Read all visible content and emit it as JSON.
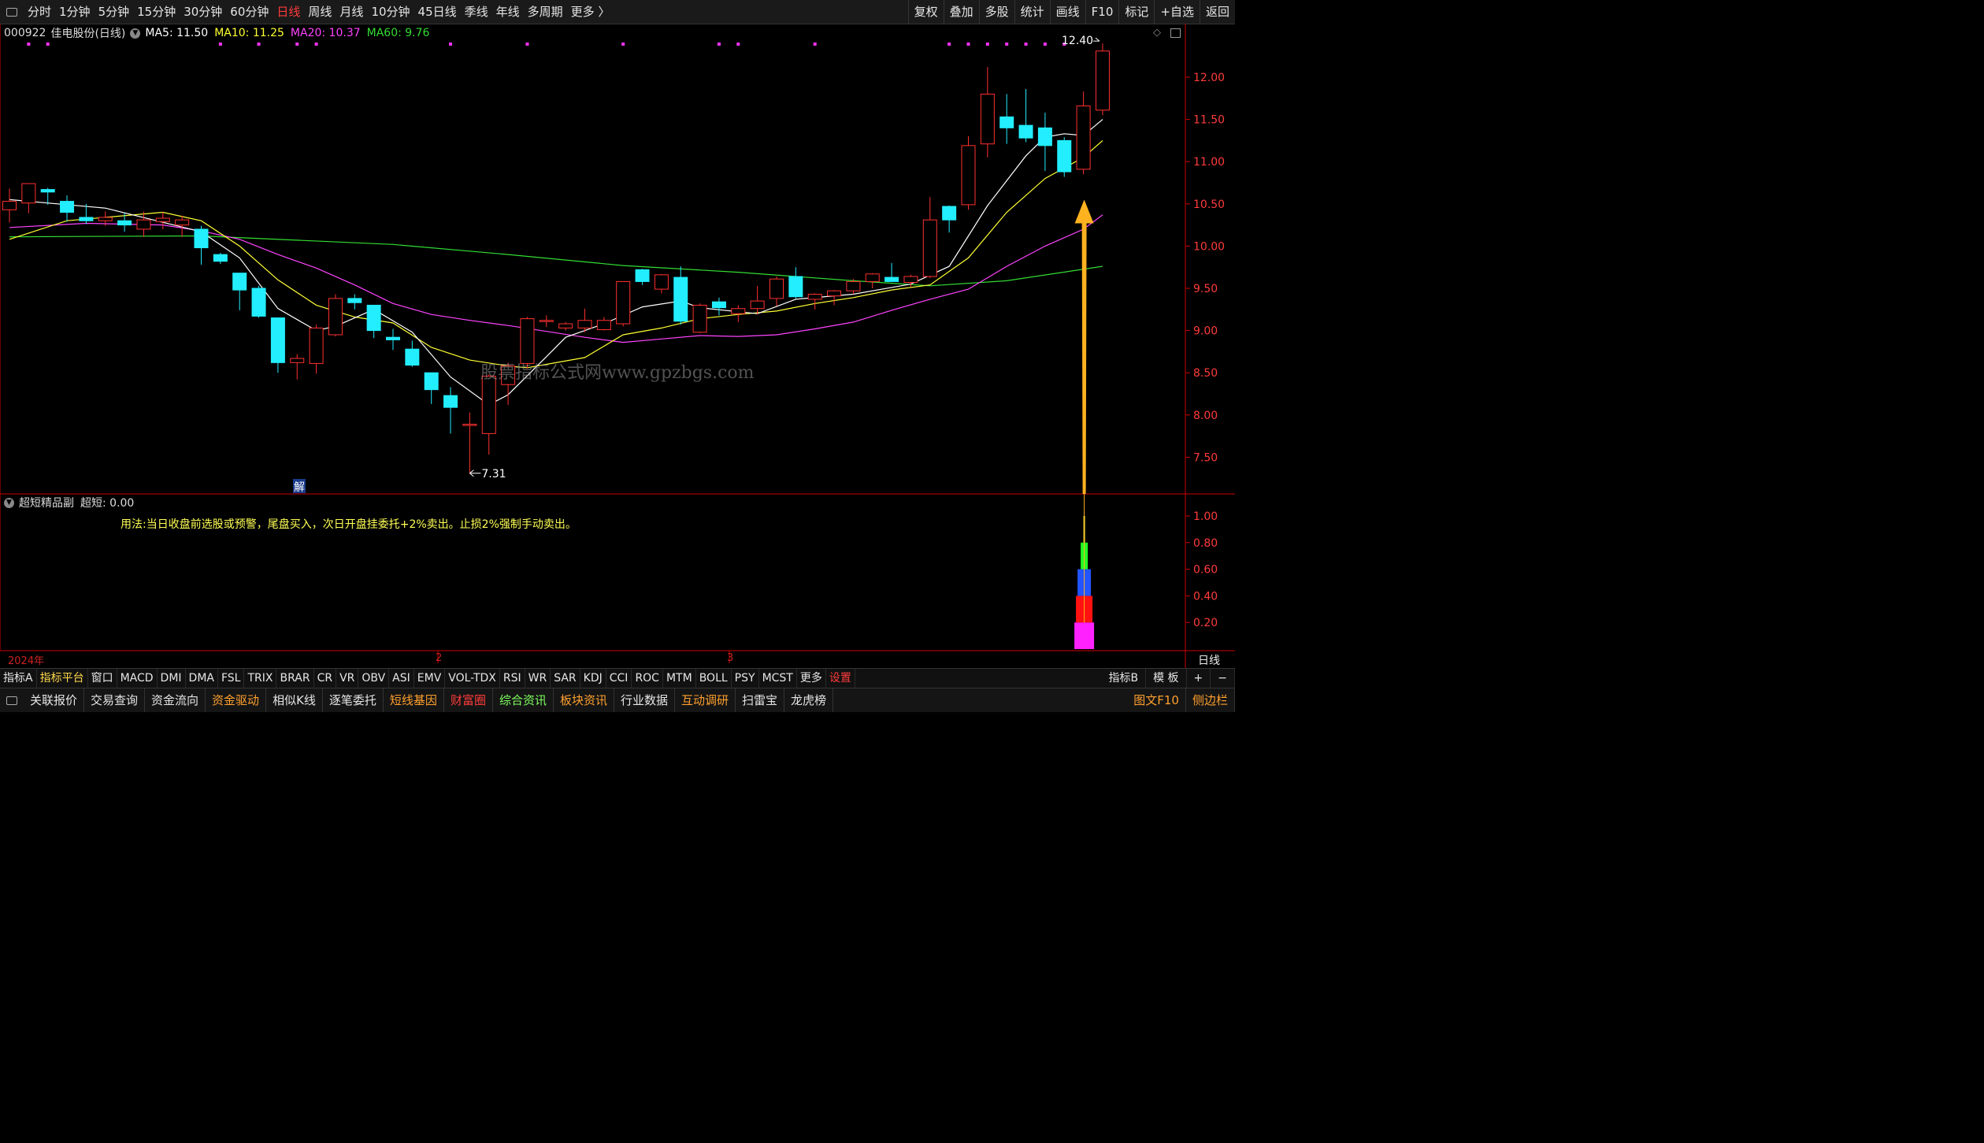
{
  "periods": [
    "分时",
    "1分钟",
    "5分钟",
    "15分钟",
    "30分钟",
    "60分钟",
    "日线",
    "周线",
    "月线",
    "10分钟",
    "45日线",
    "季线",
    "年线",
    "多周期",
    "更多 〉"
  ],
  "active_period": "日线",
  "top_right": [
    "复权",
    "叠加",
    "多股",
    "统计",
    "画线",
    "F10",
    "标记",
    "+自选",
    "返回"
  ],
  "stock": {
    "code": "000922",
    "name": "佳电股份",
    "period": "(日线)"
  },
  "ma_legend": [
    {
      "label": "MA5: 11.50",
      "color": "#ffffff"
    },
    {
      "label": "MA10: 11.25",
      "color": "#ffff33"
    },
    {
      "label": "MA20: 10.37",
      "color": "#ff44ff"
    },
    {
      "label": "MA60: 9.76",
      "color": "#33dd33"
    }
  ],
  "price_axis": [
    "12.00",
    "11.50",
    "11.00",
    "10.50",
    "10.00",
    "9.50",
    "9.00",
    "8.50",
    "8.00",
    "7.50"
  ],
  "annotations": {
    "high_label": "12.40",
    "low_label": "7.31",
    "jie": "解",
    "watermark": "股票指标公式网www.gpzbgs.com"
  },
  "sub_panel": {
    "title": "超短精品副",
    "value_label": "超短: 0.00",
    "note": "用法:当日收盘前选股或预警，尾盘买入，次日开盘挂委托+2%卖出。止损2%强制手动卖出。",
    "axis": [
      "1.00",
      "0.80",
      "0.60",
      "0.40",
      "0.20"
    ]
  },
  "time_axis": {
    "year": "2024年",
    "m2": "2",
    "m3": "3",
    "period_label": "日线"
  },
  "indicator_tabs": [
    "指标A",
    "指标平台",
    "窗口",
    "MACD",
    "DMI",
    "DMA",
    "FSL",
    "TRIX",
    "BRAR",
    "CR",
    "VR",
    "OBV",
    "ASI",
    "EMV",
    "VOL-TDX",
    "RSI",
    "WR",
    "SAR",
    "KDJ",
    "CCI",
    "ROC",
    "MTM",
    "BOLL",
    "PSY",
    "MCST",
    "更多",
    "设置"
  ],
  "indicator_right": [
    "指标B",
    "模 板",
    "+",
    "−"
  ],
  "func_buttons": [
    {
      "label": "关联报价",
      "c": ""
    },
    {
      "label": "交易查询",
      "c": ""
    },
    {
      "label": "资金流向",
      "c": ""
    },
    {
      "label": "资金驱动",
      "c": "o"
    },
    {
      "label": "相似K线",
      "c": ""
    },
    {
      "label": "逐笔委托",
      "c": ""
    },
    {
      "label": "短线基因",
      "c": "o"
    },
    {
      "label": "财富圈",
      "c": "r"
    },
    {
      "label": "综合资讯",
      "c": "g"
    },
    {
      "label": "板块资讯",
      "c": "o"
    },
    {
      "label": "行业数据",
      "c": ""
    },
    {
      "label": "互动调研",
      "c": "o"
    },
    {
      "label": "扫雷宝",
      "c": ""
    },
    {
      "label": "龙虎榜",
      "c": ""
    }
  ],
  "func_right": [
    "图文F10",
    "侧边栏"
  ],
  "chart_data": {
    "type": "candlestick",
    "candles": [
      {
        "o": 10.43,
        "h": 10.68,
        "l": 10.28,
        "c": 10.53
      },
      {
        "o": 10.51,
        "h": 10.74,
        "l": 10.39,
        "c": 10.74
      },
      {
        "o": 10.67,
        "h": 10.69,
        "l": 10.49,
        "c": 10.64
      },
      {
        "o": 10.53,
        "h": 10.6,
        "l": 10.29,
        "c": 10.4
      },
      {
        "o": 10.34,
        "h": 10.5,
        "l": 10.26,
        "c": 10.3
      },
      {
        "o": 10.3,
        "h": 10.41,
        "l": 10.24,
        "c": 10.34
      },
      {
        "o": 10.3,
        "h": 10.39,
        "l": 10.17,
        "c": 10.25
      },
      {
        "o": 10.2,
        "h": 10.41,
        "l": 10.11,
        "c": 10.31
      },
      {
        "o": 10.29,
        "h": 10.4,
        "l": 10.2,
        "c": 10.33
      },
      {
        "o": 10.25,
        "h": 10.36,
        "l": 10.11,
        "c": 10.31
      },
      {
        "o": 10.2,
        "h": 10.24,
        "l": 9.78,
        "c": 9.98
      },
      {
        "o": 9.9,
        "h": 9.92,
        "l": 9.79,
        "c": 9.82
      },
      {
        "o": 9.68,
        "h": 9.68,
        "l": 9.24,
        "c": 9.48
      },
      {
        "o": 9.5,
        "h": 9.53,
        "l": 9.15,
        "c": 9.17
      },
      {
        "o": 9.15,
        "h": 9.15,
        "l": 8.5,
        "c": 8.62
      },
      {
        "o": 8.62,
        "h": 8.72,
        "l": 8.42,
        "c": 8.67
      },
      {
        "o": 8.61,
        "h": 9.07,
        "l": 8.49,
        "c": 9.03
      },
      {
        "o": 8.95,
        "h": 9.43,
        "l": 8.93,
        "c": 9.38
      },
      {
        "o": 9.38,
        "h": 9.43,
        "l": 9.25,
        "c": 9.33
      },
      {
        "o": 9.3,
        "h": 9.3,
        "l": 8.91,
        "c": 9.0
      },
      {
        "o": 8.92,
        "h": 9.02,
        "l": 8.77,
        "c": 8.89
      },
      {
        "o": 8.78,
        "h": 8.88,
        "l": 8.57,
        "c": 8.59
      },
      {
        "o": 8.5,
        "h": 8.5,
        "l": 8.13,
        "c": 8.3
      },
      {
        "o": 8.23,
        "h": 8.33,
        "l": 7.78,
        "c": 8.09
      },
      {
        "o": 7.89,
        "h": 8.03,
        "l": 7.31,
        "c": 7.89
      },
      {
        "o": 7.78,
        "h": 8.48,
        "l": 7.53,
        "c": 8.46
      },
      {
        "o": 8.36,
        "h": 8.62,
        "l": 8.12,
        "c": 8.58
      },
      {
        "o": 8.61,
        "h": 9.16,
        "l": 8.55,
        "c": 9.14
      },
      {
        "o": 9.12,
        "h": 9.18,
        "l": 9.04,
        "c": 9.12
      },
      {
        "o": 9.03,
        "h": 9.1,
        "l": 9.0,
        "c": 9.08
      },
      {
        "o": 9.03,
        "h": 9.26,
        "l": 8.98,
        "c": 9.12
      },
      {
        "o": 9.01,
        "h": 9.16,
        "l": 9.0,
        "c": 9.12
      },
      {
        "o": 9.08,
        "h": 9.58,
        "l": 9.05,
        "c": 9.58
      },
      {
        "o": 9.72,
        "h": 9.73,
        "l": 9.54,
        "c": 9.58
      },
      {
        "o": 9.49,
        "h": 9.67,
        "l": 9.44,
        "c": 9.66
      },
      {
        "o": 9.63,
        "h": 9.76,
        "l": 9.07,
        "c": 9.11
      },
      {
        "o": 8.98,
        "h": 9.32,
        "l": 8.97,
        "c": 9.3
      },
      {
        "o": 9.34,
        "h": 9.39,
        "l": 9.18,
        "c": 9.27
      },
      {
        "o": 9.2,
        "h": 9.3,
        "l": 9.1,
        "c": 9.26
      },
      {
        "o": 9.26,
        "h": 9.53,
        "l": 9.19,
        "c": 9.35
      },
      {
        "o": 9.38,
        "h": 9.64,
        "l": 9.29,
        "c": 9.61
      },
      {
        "o": 9.64,
        "h": 9.75,
        "l": 9.38,
        "c": 9.4
      },
      {
        "o": 9.37,
        "h": 9.44,
        "l": 9.25,
        "c": 9.43
      },
      {
        "o": 9.41,
        "h": 9.48,
        "l": 9.3,
        "c": 9.47
      },
      {
        "o": 9.47,
        "h": 9.61,
        "l": 9.43,
        "c": 9.58
      },
      {
        "o": 9.58,
        "h": 9.68,
        "l": 9.5,
        "c": 9.67
      },
      {
        "o": 9.63,
        "h": 9.8,
        "l": 9.58,
        "c": 9.58
      },
      {
        "o": 9.57,
        "h": 9.66,
        "l": 9.52,
        "c": 9.64
      },
      {
        "o": 9.64,
        "h": 10.58,
        "l": 9.62,
        "c": 10.31
      },
      {
        "o": 10.47,
        "h": 10.48,
        "l": 10.16,
        "c": 10.31
      },
      {
        "o": 10.49,
        "h": 11.3,
        "l": 10.43,
        "c": 11.19
      },
      {
        "o": 11.21,
        "h": 12.12,
        "l": 11.05,
        "c": 11.8
      },
      {
        "o": 11.53,
        "h": 11.8,
        "l": 11.21,
        "c": 11.4
      },
      {
        "o": 11.43,
        "h": 11.86,
        "l": 11.23,
        "c": 11.28
      },
      {
        "o": 11.4,
        "h": 11.58,
        "l": 10.89,
        "c": 11.19
      },
      {
        "o": 11.25,
        "h": 11.29,
        "l": 10.82,
        "c": 10.88
      },
      {
        "o": 10.91,
        "h": 11.83,
        "l": 10.85,
        "c": 11.66
      },
      {
        "o": 11.61,
        "h": 12.4,
        "l": 11.55,
        "c": 12.31
      }
    ],
    "ma5": [
      [
        0,
        10.55
      ],
      [
        5,
        10.45
      ],
      [
        10,
        10.17
      ],
      [
        12,
        9.86
      ],
      [
        14,
        9.26
      ],
      [
        16,
        9.0
      ],
      [
        17,
        9.05
      ],
      [
        19,
        9.25
      ],
      [
        21,
        8.98
      ],
      [
        23,
        8.45
      ],
      [
        25,
        8.12
      ],
      [
        26,
        8.24
      ],
      [
        28,
        8.69
      ],
      [
        29,
        8.92
      ],
      [
        31,
        9.08
      ],
      [
        33,
        9.28
      ],
      [
        35,
        9.35
      ],
      [
        36,
        9.27
      ],
      [
        39,
        9.2
      ],
      [
        41,
        9.37
      ],
      [
        44,
        9.43
      ],
      [
        47,
        9.55
      ],
      [
        49,
        9.76
      ],
      [
        51,
        10.48
      ],
      [
        53,
        11.07
      ],
      [
        54,
        11.29
      ],
      [
        55,
        11.33
      ],
      [
        56,
        11.31
      ],
      [
        57,
        11.5
      ]
    ],
    "ma10": [
      [
        0,
        10.08
      ],
      [
        3,
        10.3
      ],
      [
        8,
        10.4
      ],
      [
        10,
        10.3
      ],
      [
        12,
        10.0
      ],
      [
        14,
        9.6
      ],
      [
        16,
        9.3
      ],
      [
        18,
        9.16
      ],
      [
        20,
        9.09
      ],
      [
        22,
        8.8
      ],
      [
        24,
        8.65
      ],
      [
        26,
        8.58
      ],
      [
        27,
        8.56
      ],
      [
        28,
        8.6
      ],
      [
        30,
        8.68
      ],
      [
        32,
        8.95
      ],
      [
        34,
        9.03
      ],
      [
        36,
        9.14
      ],
      [
        38,
        9.19
      ],
      [
        40,
        9.23
      ],
      [
        42,
        9.32
      ],
      [
        44,
        9.39
      ],
      [
        46,
        9.48
      ],
      [
        48,
        9.54
      ],
      [
        50,
        9.86
      ],
      [
        52,
        10.4
      ],
      [
        54,
        10.8
      ],
      [
        56,
        11.05
      ],
      [
        57,
        11.25
      ]
    ],
    "ma20": [
      [
        0,
        10.22
      ],
      [
        4,
        10.27
      ],
      [
        8,
        10.25
      ],
      [
        10,
        10.18
      ],
      [
        12,
        10.08
      ],
      [
        14,
        9.9
      ],
      [
        16,
        9.74
      ],
      [
        18,
        9.54
      ],
      [
        20,
        9.32
      ],
      [
        22,
        9.19
      ],
      [
        24,
        9.12
      ],
      [
        26,
        9.06
      ],
      [
        28,
        8.99
      ],
      [
        30,
        8.92
      ],
      [
        32,
        8.86
      ],
      [
        34,
        8.9
      ],
      [
        36,
        8.94
      ],
      [
        38,
        8.93
      ],
      [
        40,
        8.95
      ],
      [
        42,
        9.02
      ],
      [
        44,
        9.1
      ],
      [
        46,
        9.24
      ],
      [
        48,
        9.37
      ],
      [
        50,
        9.49
      ],
      [
        52,
        9.76
      ],
      [
        54,
        10.0
      ],
      [
        56,
        10.2
      ],
      [
        57,
        10.37
      ]
    ],
    "ma60": [
      [
        0,
        10.11
      ],
      [
        10,
        10.12
      ],
      [
        20,
        10.02
      ],
      [
        26,
        9.9
      ],
      [
        32,
        9.77
      ],
      [
        38,
        9.69
      ],
      [
        44,
        9.59
      ],
      [
        48,
        9.53
      ],
      [
        52,
        9.59
      ],
      [
        57,
        9.76
      ]
    ],
    "signal_bar": {
      "index": 56,
      "segments": [
        {
          "from": 0,
          "to": 0.2,
          "color": "#ff22ff"
        },
        {
          "from": 0.2,
          "to": 0.4,
          "color": "#ff1111"
        },
        {
          "from": 0.4,
          "to": 0.6,
          "color": "#2255ff"
        },
        {
          "from": 0.6,
          "to": 0.8,
          "color": "#22ff22"
        },
        {
          "from": 0.8,
          "to": 1.0,
          "color": "#ffff33"
        }
      ]
    },
    "dot_indices": [
      1,
      2,
      11,
      13,
      15,
      16,
      23,
      27,
      32,
      37,
      38,
      42,
      49,
      50,
      51,
      52,
      53,
      54,
      55
    ],
    "colors": {
      "up": "#ff3030",
      "down": "#22eeff",
      "ma5": "#ffffff",
      "ma10": "#ffff33",
      "ma20": "#ff44ff",
      "ma60": "#33dd33",
      "axis": "#cc0000",
      "arrow": "#ffb21f"
    }
  }
}
